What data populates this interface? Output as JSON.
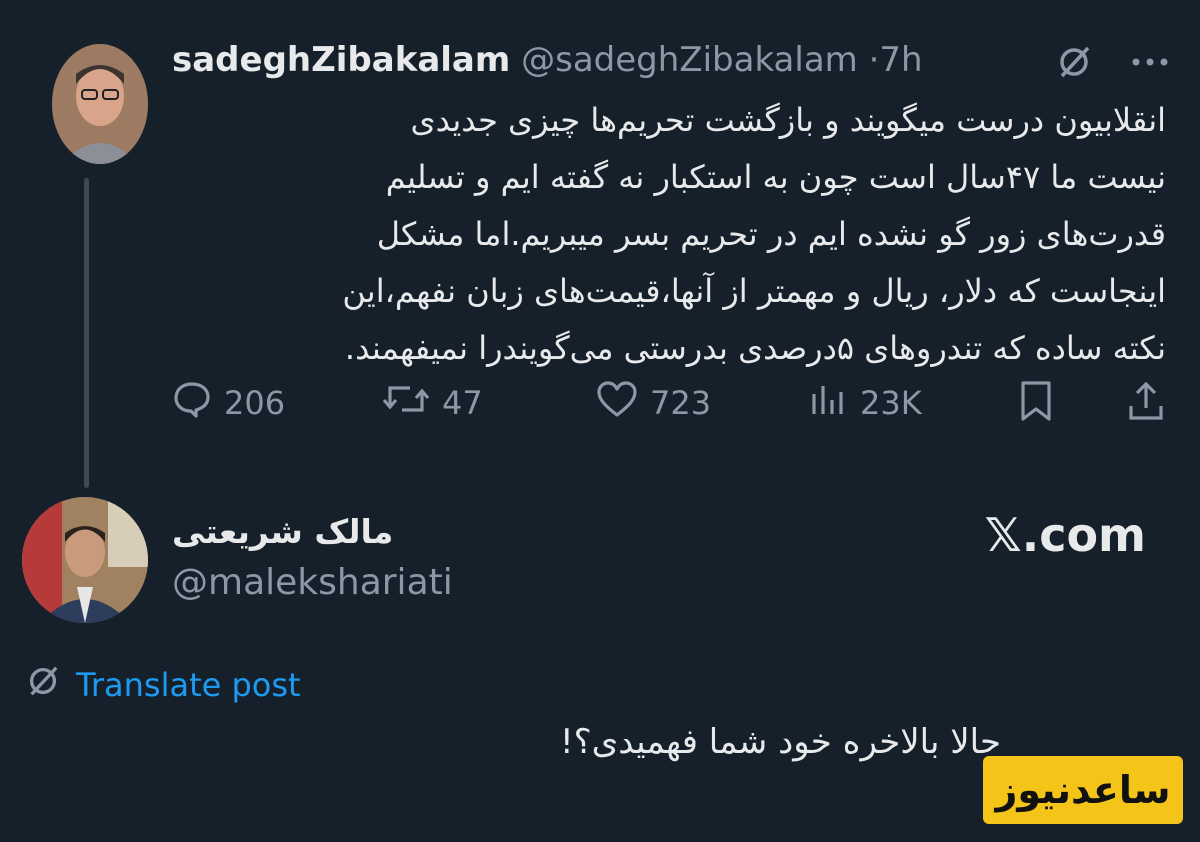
{
  "tweet": {
    "author_name": "sadeghZibakalam",
    "author_handle": "@sadeghZibakalam",
    "separator": "·",
    "time": "7h",
    "text_lines": [
      "انقلابیون درست میگویند و بازگشت تحریم‌ها چیزی جدیدی",
      "نیست ما ۴۷سال است چون به استکبار نه گفته ایم و تسلیم",
      "قدرت‌های زور گو نشده ایم در تحریم بسر میبریم.اما مشکل",
      "اینجاست که دلار، ریال و مهمتر از آنها،قیمت‌های زبان نفهم،این",
      "نکته ساده که تندروهای ۵درصدی بدرستی می‌گویندرا نمیفهمند."
    ],
    "stats": {
      "replies": "206",
      "reposts": "47",
      "likes": "723",
      "views": "23K"
    }
  },
  "quote": {
    "author_name": "مالک شریعتی",
    "author_handle": "@malekshariati",
    "brand": "𝕏.com"
  },
  "translate_label": "Translate post",
  "reply_text": "حالا بالاخره خود شما فهمیدی؟!",
  "watermark": "ساعدنیوز",
  "icons": [
    "grok-icon",
    "more-icon",
    "reply-icon",
    "repost-icon",
    "like-icon",
    "views-icon",
    "bookmark-icon",
    "share-icon",
    "translate-icon"
  ],
  "colors": {
    "background": "#15202b",
    "accent": "#1d9bf0",
    "muted": "#8b98a5",
    "watermark_bg": "#f4c419"
  }
}
